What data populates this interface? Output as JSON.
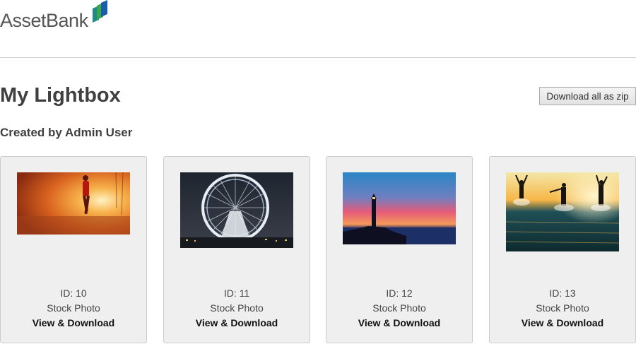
{
  "header": {
    "logo_text": "AssetBank",
    "logo_colors": [
      "#1e8a8a",
      "#3aa84a",
      "#1b5ea8"
    ]
  },
  "page": {
    "title": "My Lightbox",
    "download_zip_label": "Download all as zip",
    "created_by": "Created by Admin User"
  },
  "cards": [
    {
      "id_text": "ID: 10",
      "type": "Stock Photo",
      "link": "View & Download",
      "icon": "runner-sunset-photo"
    },
    {
      "id_text": "ID: 11",
      "type": "Stock Photo",
      "link": "View & Download",
      "icon": "ferris-wheel-night-photo"
    },
    {
      "id_text": "ID: 12",
      "type": "Stock Photo",
      "link": "View & Download",
      "icon": "lighthouse-sunset-photo"
    },
    {
      "id_text": "ID: 13",
      "type": "Stock Photo",
      "link": "View & Download",
      "icon": "people-splashing-sea-photo"
    }
  ]
}
